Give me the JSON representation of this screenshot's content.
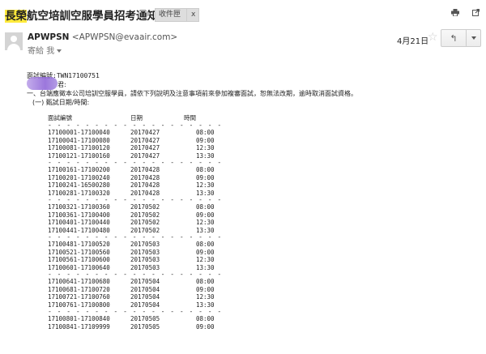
{
  "subject": {
    "highlight": "長榮",
    "rest": "航空培訓空服學員招考通知",
    "label": "收件匣",
    "label_close": "x"
  },
  "sender": {
    "name": "APWPSN",
    "email": "<APWPSN@evaair.com>",
    "to_prefix": "寄給",
    "to_name": "我",
    "date": "4月21日",
    "star": "☆",
    "reply": "↰"
  },
  "body": {
    "ref": "面試編號:TWN17100751",
    "greeting": "君:",
    "intro": "一、台端應徵本公司培訓空服學員，請依下列說明及注意事項前來參加複審面試，恕無法改期，逾時取消面試資格。",
    "section": "(一) 甄試日期/時間:"
  },
  "schedule": {
    "headers": {
      "id": "面試編號",
      "date": "日期",
      "time": "時間"
    },
    "rule": "- - - - - - - - - - - - - - - - - - - - - - - - - - - - - - - - - - - - - -",
    "groups": [
      [
        {
          "id": "17100001-17100040",
          "date": "20170427",
          "time": "08:00"
        },
        {
          "id": "17100041-17100080",
          "date": "20170427",
          "time": "09:00"
        },
        {
          "id": "17100081-17100120",
          "date": "20170427",
          "time": "12:30"
        },
        {
          "id": "17100121-17100160",
          "date": "20170427",
          "time": "13:30"
        }
      ],
      [
        {
          "id": "17100161-17100200",
          "date": "20170428",
          "time": "08:00"
        },
        {
          "id": "17100201-17100240",
          "date": "20170428",
          "time": "09:00"
        },
        {
          "id": "17100241-16500280",
          "date": "20170428",
          "time": "12:30"
        },
        {
          "id": "17100281-17100320",
          "date": "20170428",
          "time": "13:30"
        }
      ],
      [
        {
          "id": "17100321-17100360",
          "date": "20170502",
          "time": "08:00"
        },
        {
          "id": "17100361-17100400",
          "date": "20170502",
          "time": "09:00"
        },
        {
          "id": "17100401-17100440",
          "date": "20170502",
          "time": "12:30"
        },
        {
          "id": "17100441-17100480",
          "date": "20170502",
          "time": "13:30"
        }
      ],
      [
        {
          "id": "17100481-17100520",
          "date": "20170503",
          "time": "08:00"
        },
        {
          "id": "17100521-17100560",
          "date": "20170503",
          "time": "09:00"
        },
        {
          "id": "17100561-17100600",
          "date": "20170503",
          "time": "12:30"
        },
        {
          "id": "17100601-17100640",
          "date": "20170503",
          "time": "13:30"
        }
      ],
      [
        {
          "id": "17100641-17100680",
          "date": "20170504",
          "time": "08:00"
        },
        {
          "id": "17100681-17100720",
          "date": "20170504",
          "time": "09:00"
        },
        {
          "id": "17100721-17100760",
          "date": "20170504",
          "time": "12:30"
        },
        {
          "id": "17100761-17100800",
          "date": "20170504",
          "time": "13:30"
        }
      ],
      [
        {
          "id": "17100801-17100840",
          "date": "20170505",
          "time": "08:00"
        },
        {
          "id": "17100841-17109999",
          "date": "20170505",
          "time": "09:00"
        }
      ]
    ]
  }
}
